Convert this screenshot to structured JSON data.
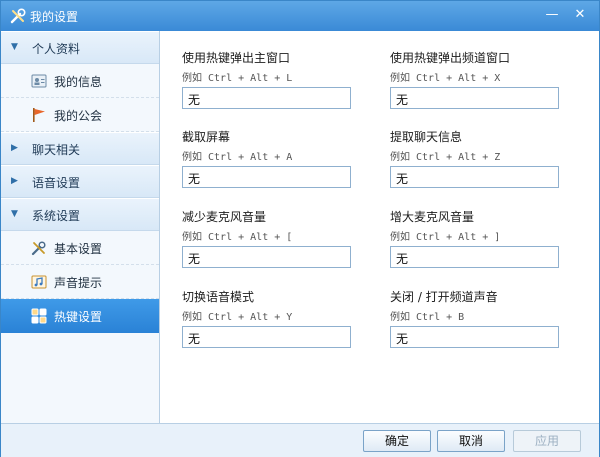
{
  "window": {
    "title": "我的设置"
  },
  "sidebar": {
    "groups": [
      {
        "label": "个人资料",
        "expanded": true
      },
      {
        "label": "聊天相关",
        "expanded": false
      },
      {
        "label": "语音设置",
        "expanded": false
      },
      {
        "label": "系统设置",
        "expanded": true
      }
    ],
    "items": [
      {
        "label": "我的信息",
        "icon": "id-card-icon"
      },
      {
        "label": "我的公会",
        "icon": "flag-icon"
      },
      {
        "label": "基本设置",
        "icon": "tools-icon"
      },
      {
        "label": "声音提示",
        "icon": "sound-note-icon"
      },
      {
        "label": "热键设置",
        "icon": "keyboard-grid-icon",
        "active": true
      }
    ]
  },
  "hotkeys": [
    {
      "label": "使用热键弹出主窗口",
      "hint": "例如 Ctrl + Alt + L",
      "value": "无"
    },
    {
      "label": "使用热键弹出频道窗口",
      "hint": "例如 Ctrl + Alt + X",
      "value": "无"
    },
    {
      "label": "截取屏幕",
      "hint": "例如 Ctrl + Alt + A",
      "value": "无"
    },
    {
      "label": "提取聊天信息",
      "hint": "例如 Ctrl + Alt + Z",
      "value": "无"
    },
    {
      "label": "减少麦克风音量",
      "hint": "例如 Ctrl + Alt + [",
      "value": "无"
    },
    {
      "label": "增大麦克风音量",
      "hint": "例如 Ctrl + Alt + ]",
      "value": "无"
    },
    {
      "label": "切换语音模式",
      "hint": "例如 Ctrl + Alt + Y",
      "value": "无"
    },
    {
      "label": "关闭 / 打开频道声音",
      "hint": "例如 Ctrl + B",
      "value": "无"
    }
  ],
  "footer": {
    "ok": "确定",
    "cancel": "取消",
    "apply": "应用"
  },
  "colors": {
    "titlebar": "#3a8ad6",
    "active_item": "#2a82d6"
  }
}
